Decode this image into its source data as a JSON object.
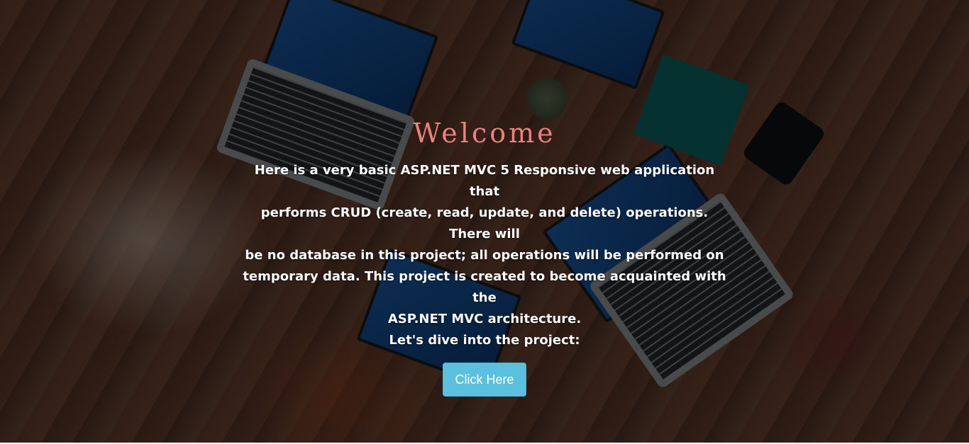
{
  "hero": {
    "title": "Welcome",
    "description_lines": [
      "Here is a very basic ASP.NET MVC 5 Responsive web application that",
      "performs CRUD (create, read, update, and delete) operations. There will",
      "be no database in this project; all operations will be performed on",
      "temporary data. This project is created to become acquainted with the",
      "ASP.NET MVC architecture."
    ],
    "intro_line": "Let's dive into the project:",
    "button_label": "Click Here",
    "background_image": "desk-laptops-photo"
  },
  "colors": {
    "title": "#f08080",
    "button": "#5bc0de",
    "overlay": "rgba(0,0,0,0.55)"
  }
}
